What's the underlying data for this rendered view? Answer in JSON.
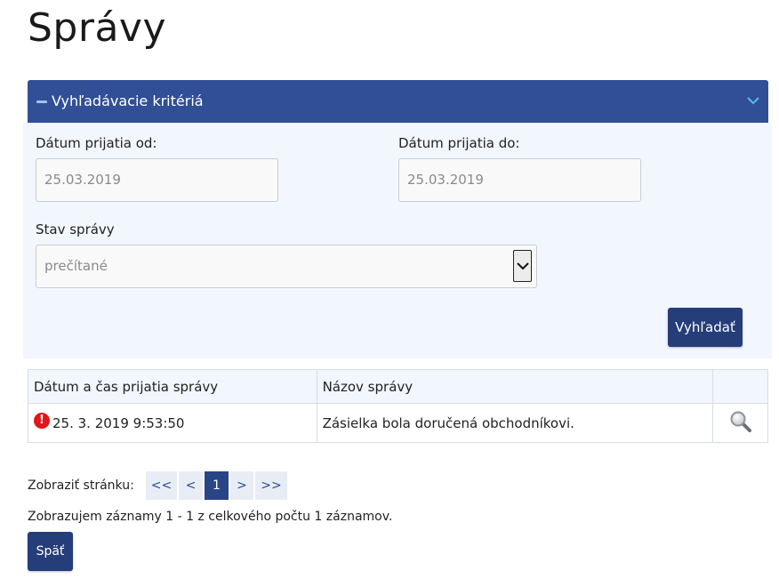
{
  "page": {
    "title": "Správy"
  },
  "filter": {
    "header": "Vyhľadávacie kritériá",
    "date_from_label": "Dátum prijatia od:",
    "date_from_value": "25.03.2019",
    "date_to_label": "Dátum prijatia do:",
    "date_to_value": "25.03.2019",
    "status_label": "Stav správy",
    "status_value": "prečítané",
    "search_button": "Vyhľadať"
  },
  "table": {
    "columns": [
      "Dátum a čas prijatia správy",
      "Názov správy",
      ""
    ],
    "rows": [
      {
        "datetime": "25. 3. 2019 9:53:50",
        "name": "Zásielka bola doručená obchodníkovi.",
        "alert_icon": "!"
      }
    ]
  },
  "pager": {
    "label": "Zobraziť stránku:",
    "first": "<<",
    "prev": "<",
    "current": "1",
    "next": ">",
    "last": ">>",
    "records_text": "Zobrazujem záznamy 1 - 1 z celkového počtu 1 záznamov."
  },
  "back_button": "Späť",
  "colors": {
    "header_bg": "#314f96",
    "button_bg": "#253d78",
    "panel_bg": "#f2f6fd",
    "alert": "#e0161b"
  },
  "icons": {
    "collapse": "minus-icon",
    "chevron": "chevron-down-icon",
    "detail": "magnifier-icon",
    "alert": "exclamation-icon"
  }
}
